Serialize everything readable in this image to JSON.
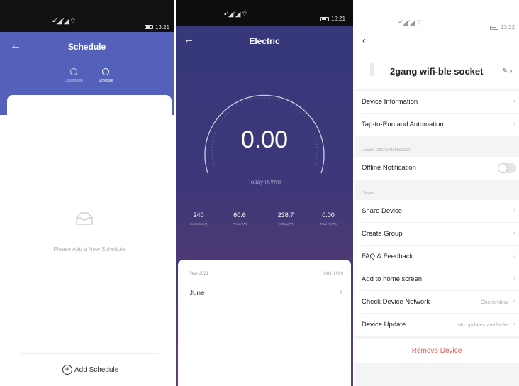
{
  "schedule_screen": {
    "status_icons": "▪︎ᐟ◢ᐟ◢ ⌔",
    "status_time": "13:21",
    "title": "Schedule",
    "tabs": [
      {
        "label": "Countdown",
        "icon": "clock-icon"
      },
      {
        "label": "Schedule",
        "icon": "alarm-icon"
      }
    ],
    "empty_text": "Please Add a New Schedule",
    "add_button": "Add Schedule",
    "colors": {
      "header": "#5461bb"
    }
  },
  "electric_screen": {
    "status_icons": "▪︎ᐟ◢ᐟ◢ ⌔",
    "status_time": "13:21",
    "title": "Electric",
    "value": "0.00",
    "value_unit": "Today (KWh)",
    "stats": [
      {
        "value": "240",
        "label": "Current(mA)"
      },
      {
        "value": "60.6",
        "label": "Power(W)"
      },
      {
        "value": "238.7",
        "label": "Voltage(V)"
      },
      {
        "value": "0.00",
        "label": "Total (KWh)"
      }
    ],
    "year_label": "Year 2021",
    "unit_label": "Unit: kW.h",
    "month": "June",
    "colors": {
      "gradient_top": "#34387a",
      "gradient_bottom": "#604070"
    }
  },
  "settings_screen": {
    "status_icons": "▪︎ᐟ◢ᐟ◢ ⌔",
    "status_time": "13:22",
    "device_name": "2gang wifi-ble socket",
    "rows_group1": [
      {
        "label": "Device Information"
      },
      {
        "label": "Tap-to-Run and Automation"
      }
    ],
    "section_offline": "Device Offline Notification",
    "offline_row": {
      "label": "Offline Notification",
      "enabled": false
    },
    "section_others": "Others",
    "rows_group2": [
      {
        "label": "Share Device",
        "value": ""
      },
      {
        "label": "Create Group",
        "value": ""
      },
      {
        "label": "FAQ & Feedback",
        "value": ""
      },
      {
        "label": "Add to home screen",
        "value": ""
      },
      {
        "label": "Check Device Network",
        "value": "Check Now"
      },
      {
        "label": "Device Update",
        "value": "No updates available"
      }
    ],
    "remove_button": "Remove Device",
    "colors": {
      "remove": "#e95a5a"
    }
  }
}
